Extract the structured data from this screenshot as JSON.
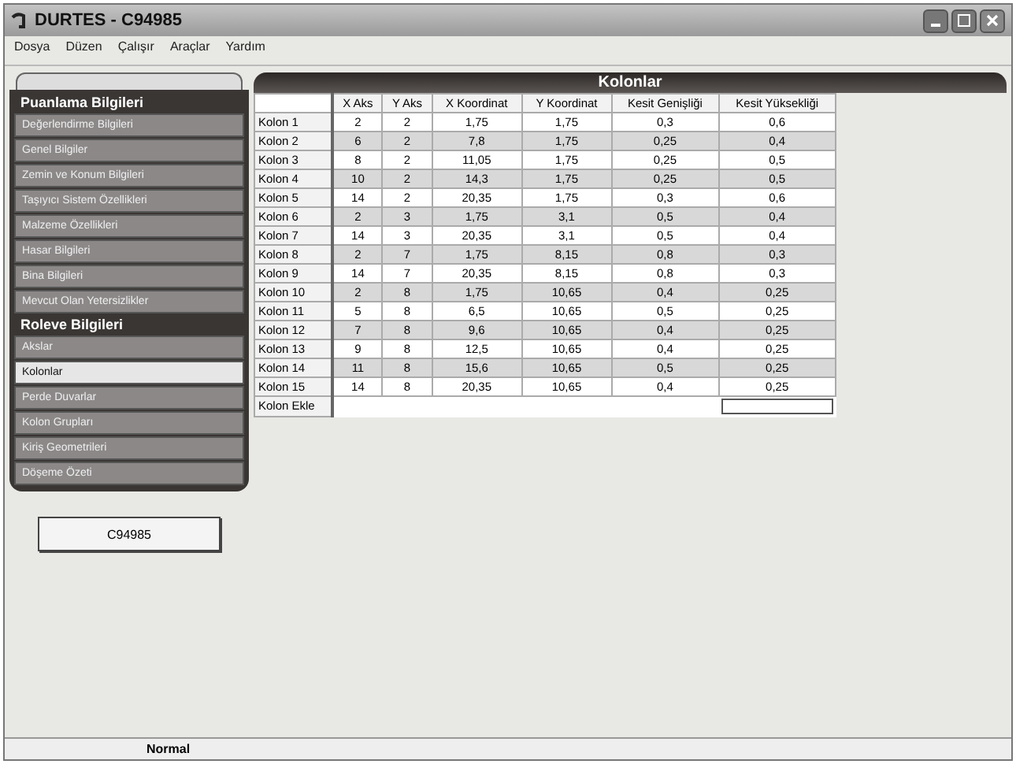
{
  "window": {
    "title": "DURTES - C94985"
  },
  "menu": [
    "Dosya",
    "Düzen",
    "Çalışır",
    "Araçlar",
    "Yardım"
  ],
  "sidebar": {
    "groups": [
      {
        "title": "Puanlama Bilgileri",
        "items": [
          {
            "label": "Değerlendirme Bilgileri",
            "selected": false
          },
          {
            "label": "Genel Bilgiler",
            "selected": false
          },
          {
            "label": "Zemin ve Konum Bilgileri",
            "selected": false
          },
          {
            "label": "Taşıyıcı Sistem Özellikleri",
            "selected": false
          },
          {
            "label": "Malzeme Özellikleri",
            "selected": false
          },
          {
            "label": "Hasar Bilgileri",
            "selected": false
          },
          {
            "label": "Bina Bilgileri",
            "selected": false
          },
          {
            "label": "Mevcut Olan Yetersizlikler",
            "selected": false
          }
        ]
      },
      {
        "title": "Roleve Bilgileri",
        "items": [
          {
            "label": "Akslar",
            "selected": false
          },
          {
            "label": "Kolonlar",
            "selected": true
          },
          {
            "label": "Perde Duvarlar",
            "selected": false
          },
          {
            "label": "Kolon Grupları",
            "selected": false
          },
          {
            "label": "Kiriş Geometrileri",
            "selected": false
          },
          {
            "label": "Döşeme Özeti",
            "selected": false
          }
        ]
      }
    ],
    "button": "C94985"
  },
  "panel": {
    "title": "Kolonlar",
    "columns": [
      "X Aks",
      "Y Aks",
      "X Koordinat",
      "Y Koordinat",
      "Kesit Genişliği",
      "Kesit Yüksekliği"
    ],
    "rows": [
      {
        "name": "Kolon 1",
        "cells": [
          "2",
          "2",
          "1,75",
          "1,75",
          "0,3",
          "0,6"
        ]
      },
      {
        "name": "Kolon 2",
        "cells": [
          "6",
          "2",
          "7,8",
          "1,75",
          "0,25",
          "0,4"
        ]
      },
      {
        "name": "Kolon 3",
        "cells": [
          "8",
          "2",
          "11,05",
          "1,75",
          "0,25",
          "0,5"
        ]
      },
      {
        "name": "Kolon 4",
        "cells": [
          "10",
          "2",
          "14,3",
          "1,75",
          "0,25",
          "0,5"
        ]
      },
      {
        "name": "Kolon 5",
        "cells": [
          "14",
          "2",
          "20,35",
          "1,75",
          "0,3",
          "0,6"
        ]
      },
      {
        "name": "Kolon 6",
        "cells": [
          "2",
          "3",
          "1,75",
          "3,1",
          "0,5",
          "0,4"
        ]
      },
      {
        "name": "Kolon 7",
        "cells": [
          "14",
          "3",
          "20,35",
          "3,1",
          "0,5",
          "0,4"
        ]
      },
      {
        "name": "Kolon 8",
        "cells": [
          "2",
          "7",
          "1,75",
          "8,15",
          "0,8",
          "0,3"
        ]
      },
      {
        "name": "Kolon 9",
        "cells": [
          "14",
          "7",
          "20,35",
          "8,15",
          "0,8",
          "0,3"
        ]
      },
      {
        "name": "Kolon 10",
        "cells": [
          "2",
          "8",
          "1,75",
          "10,65",
          "0,4",
          "0,25"
        ]
      },
      {
        "name": "Kolon 11",
        "cells": [
          "5",
          "8",
          "6,5",
          "10,65",
          "0,5",
          "0,25"
        ]
      },
      {
        "name": "Kolon 12",
        "cells": [
          "7",
          "8",
          "9,6",
          "10,65",
          "0,4",
          "0,25"
        ]
      },
      {
        "name": "Kolon 13",
        "cells": [
          "9",
          "8",
          "12,5",
          "10,65",
          "0,4",
          "0,25"
        ]
      },
      {
        "name": "Kolon 14",
        "cells": [
          "11",
          "8",
          "15,6",
          "10,65",
          "0,5",
          "0,25"
        ]
      },
      {
        "name": "Kolon 15",
        "cells": [
          "14",
          "8",
          "20,35",
          "10,65",
          "0,4",
          "0,25"
        ]
      }
    ],
    "add_row": "Kolon Ekle"
  },
  "status_bar": "Normal"
}
